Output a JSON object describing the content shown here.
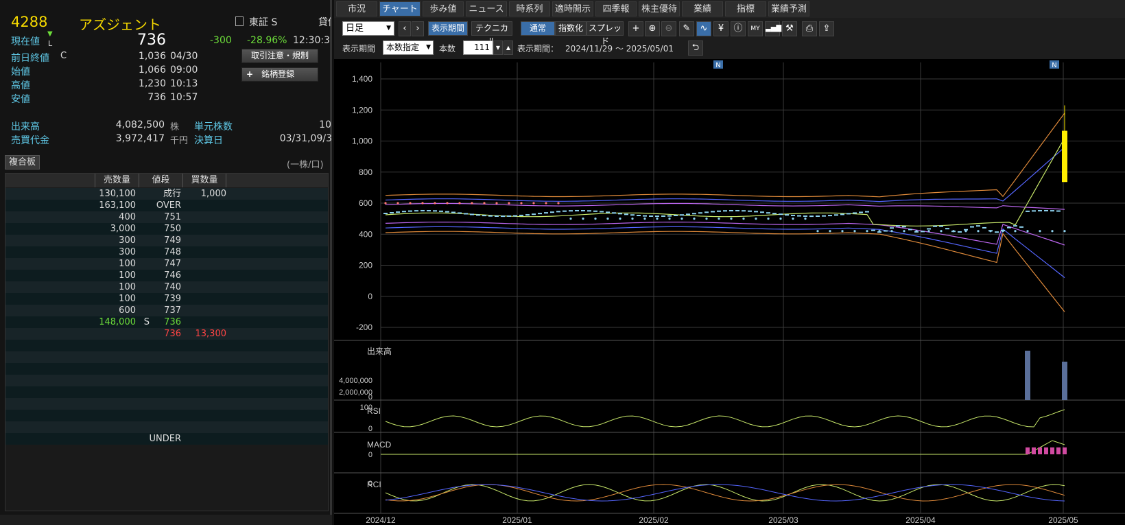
{
  "stock": {
    "code": "4288",
    "name": "アズジェント",
    "market": "東証 S",
    "market_extra": "貸借",
    "current_label": "現在値",
    "current_mark": "L",
    "current_price": "736",
    "change": "-300",
    "change_pct": "-28.96%",
    "time": "12:30:3"
  },
  "quotes": [
    {
      "label": "前日終値",
      "flag": "C",
      "value": "1,036",
      "time": "04/30"
    },
    {
      "label": "始値",
      "flag": "",
      "value": "1,066",
      "time": "09:00"
    },
    {
      "label": "高値",
      "flag": "",
      "value": "1,230",
      "time": "10:13"
    },
    {
      "label": "安値",
      "flag": "",
      "value": "736",
      "time": "10:57"
    }
  ],
  "buttons": {
    "attention": "取引注意・規制",
    "register": "銘柄登録",
    "register_plus": "+"
  },
  "stats": {
    "volume_label": "出来高",
    "volume": "4,082,500",
    "volume_unit": "株",
    "unit_label": "単元株数",
    "unit_value": "10",
    "turnover_label": "売買代金",
    "turnover": "3,972,417",
    "turnover_unit": "千円",
    "settle_label": "決算日",
    "settle_value": "03/31,09/3"
  },
  "book": {
    "title": "複合板",
    "unit_note": "(一株/口)",
    "headers": [
      "売数量",
      "値段",
      "買数量"
    ],
    "rows": [
      {
        "sell": "130,100",
        "price": "成行",
        "buy": "1,000"
      },
      {
        "sell": "163,100",
        "price": "OVER",
        "buy": ""
      },
      {
        "sell": "400",
        "price": "751",
        "buy": ""
      },
      {
        "sell": "3,000",
        "price": "750",
        "buy": ""
      },
      {
        "sell": "300",
        "price": "749",
        "buy": ""
      },
      {
        "sell": "300",
        "price": "748",
        "buy": ""
      },
      {
        "sell": "100",
        "price": "747",
        "buy": ""
      },
      {
        "sell": "100",
        "price": "746",
        "buy": ""
      },
      {
        "sell": "100",
        "price": "740",
        "buy": ""
      },
      {
        "sell": "100",
        "price": "739",
        "buy": ""
      },
      {
        "sell": "600",
        "price": "737",
        "buy": ""
      },
      {
        "sell": "148,000",
        "flag": "S",
        "price": "736",
        "buy": ""
      },
      {
        "sell": "",
        "price": "736",
        "buy": "13,300"
      },
      {
        "sell": "",
        "price": "",
        "buy": ""
      },
      {
        "sell": "",
        "price": "",
        "buy": ""
      },
      {
        "sell": "",
        "price": "",
        "buy": ""
      },
      {
        "sell": "",
        "price": "",
        "buy": ""
      },
      {
        "sell": "",
        "price": "",
        "buy": ""
      },
      {
        "sell": "",
        "price": "",
        "buy": ""
      },
      {
        "sell": "",
        "price": "",
        "buy": ""
      },
      {
        "sell": "",
        "price": "",
        "buy": ""
      },
      {
        "sell": "",
        "price": "UNDER",
        "buy": ""
      }
    ]
  },
  "tabs": [
    "市況",
    "チャート",
    "歩み値",
    "ニュース",
    "時系列",
    "適時開示",
    "四季報",
    "株主優待",
    "業績",
    "指標",
    "業績予測"
  ],
  "active_tab": 1,
  "toolbar": {
    "period_select": "日足",
    "display_period_btn": "表示期間",
    "technical_btn": "テクニカル",
    "mode_normal": "通常",
    "mode_index": "指数化",
    "mode_spread": "スプレッド",
    "period_label": "表示期間",
    "period_mode": "本数指定",
    "count_label": "本数",
    "count_value": "111",
    "range_label": "表示期間：",
    "range_value": "2024/11/29 ～ 2025/05/01"
  },
  "chart_data": {
    "type": "line",
    "main_y_ticks": [
      "1,400",
      "1,200",
      "1,000",
      "800",
      "600",
      "400",
      "200",
      "0",
      "-200"
    ],
    "x_ticks": [
      "2024/12",
      "2025/01",
      "2025/02",
      "2025/03",
      "2025/04",
      "2025/05"
    ],
    "news_markers": [
      "N",
      "N"
    ],
    "panels": [
      {
        "label": "出来高",
        "y_ticks": [
          "4,000,000",
          "2,000,000",
          "0"
        ]
      },
      {
        "label": "RSI",
        "y_ticks": [
          "100",
          "0"
        ]
      },
      {
        "label": "MACD",
        "y_ticks": [
          "0"
        ]
      },
      {
        "label": "RCI",
        "y_ticks": [
          "0"
        ]
      }
    ],
    "last_candle": {
      "open": 1066,
      "high": 1230,
      "low": 736,
      "close": 736
    },
    "colors": {
      "candle_up": "#8fd3f0",
      "candle_down": "#ffee00",
      "band_outer": "#e08a3a",
      "band_mid": "#5566ff",
      "band_inner": "#bb66ee",
      "ma": "#c8e86a",
      "grid": "#3a3a3a"
    }
  },
  "colors": {
    "accent_blue": "#3a6ea8",
    "cyan_label": "#5fc8e6",
    "price_up": "#6ddd3a",
    "price_down": "#ff4444",
    "title_yellow": "#f5d800"
  }
}
